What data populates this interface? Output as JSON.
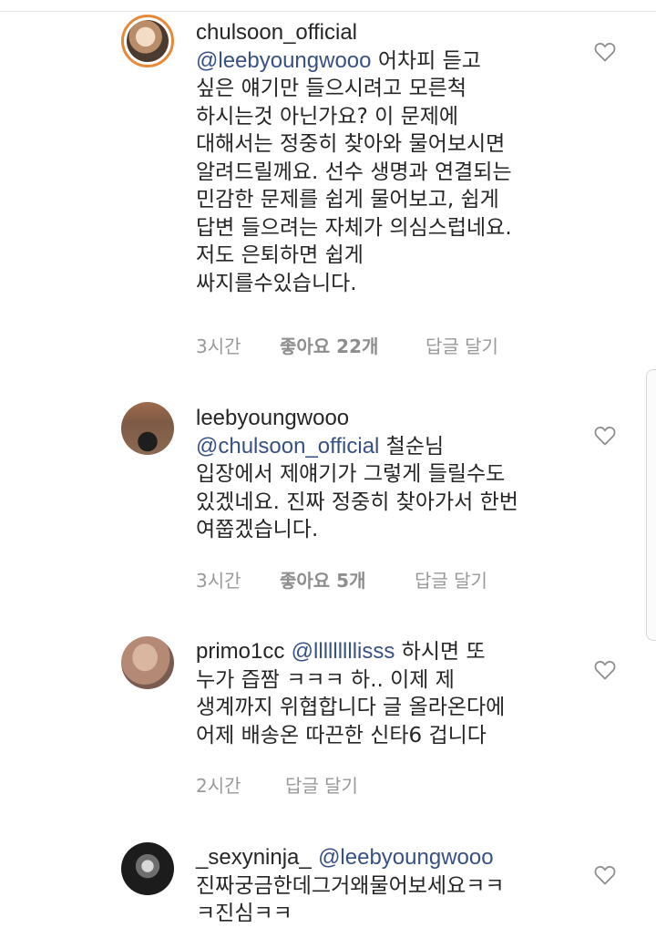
{
  "comments": [
    {
      "username": "chulsoon_official",
      "mention": "@leebyoungwooo",
      "first_line_rest": " 어차피 듣고",
      "lines": [
        "싶은 얘기만 들으시려고 모른척",
        "하시는것 아닌가요? 이 문제에",
        "대해서는 정중히 찾아와 물어보시면",
        "알려드릴께요. 선수 생명과 연결되는",
        "민감한 문제를 쉽게 물어보고, 쉽게",
        "답변 들으려는 자체가 의심스럽네요.",
        "저도 은퇴하면 쉽게",
        "싸지를수있습니다."
      ],
      "time": "3시간",
      "likes": "좋아요 22개",
      "reply": "답글 달기",
      "avatar_icon": "profile-photo"
    },
    {
      "username": "leebyoungwooo",
      "mention": "@chulsoon_official",
      "first_line_rest": " 철순님",
      "lines": [
        "입장에서 제얘기가 그렇게 들릴수도",
        "있겠네요. 진짜 정중히 찾아가서 한번",
        "여쭙겠습니다."
      ],
      "time": "3시간",
      "likes": "좋아요 5개",
      "reply": "답글 달기",
      "avatar_icon": "profile-photo"
    },
    {
      "username": "primo1cc",
      "mention": "@lllllllllisss",
      "first_line_rest": " 하시면 또",
      "lines": [
        "누가 즙짬 ㅋㅋㅋ 하.. 이제 제",
        "생계까지 위협합니다 글 올라온다에",
        "어제 배송온 따끈한 신타6 겁니다"
      ],
      "time": "2시간",
      "likes": "",
      "reply": "답글 달기",
      "avatar_icon": "profile-photo"
    },
    {
      "username": "_sexyninja_",
      "mention": "@leebyoungwooo",
      "first_line_rest": "",
      "lines": [
        "진짜궁금한데그거왜물어보세요ㅋㅋ",
        "ㅋ진심ㅋㅋ"
      ],
      "time": "",
      "likes": "",
      "reply": "",
      "avatar_icon": "profile-photo"
    }
  ],
  "icons": {
    "like": "heart-outline-icon"
  },
  "colors": {
    "text": "#262626",
    "mention": "#385185",
    "meta": "#999999",
    "avatar_ring": "#e8893a"
  }
}
